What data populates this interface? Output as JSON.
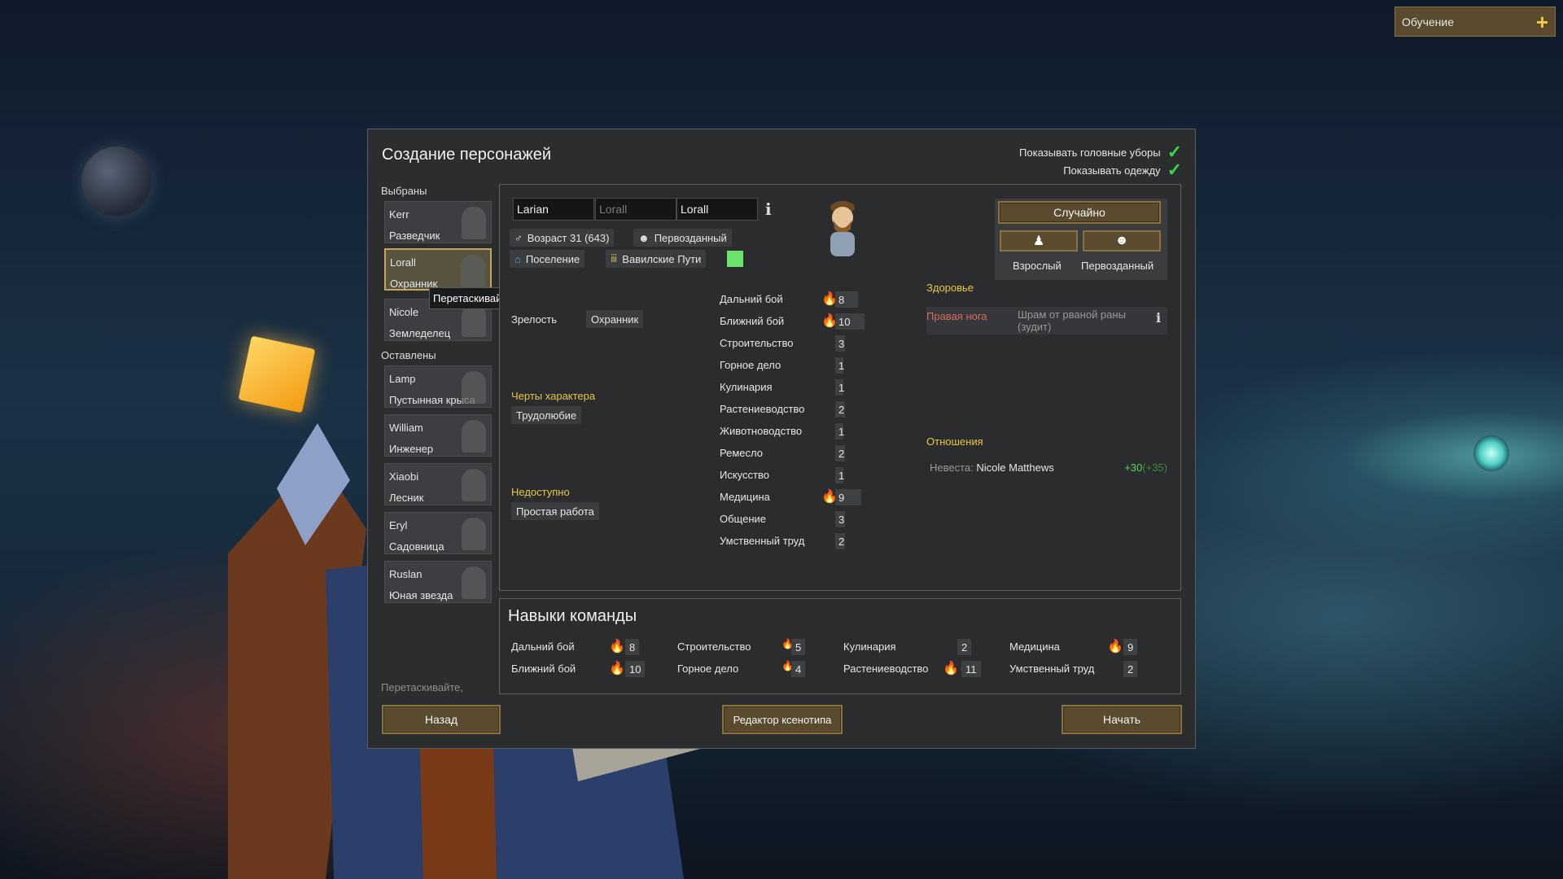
{
  "tutorial": {
    "label": "Обучение"
  },
  "dialog": {
    "title": "Создание персонажей",
    "toggles": [
      {
        "label": "Показывать головные уборы"
      },
      {
        "label": "Показывать одежду"
      }
    ],
    "chosen_label": "Выбраны",
    "left_label": "Оставлены",
    "chosen": [
      {
        "name": "Kerr",
        "role": "Разведчик"
      },
      {
        "name": "Lorall",
        "role": "Охранник"
      },
      {
        "name": "Nicole",
        "role": "Земледелец"
      }
    ],
    "left": [
      {
        "name": "Lamp",
        "role": "Пустынная крыса"
      },
      {
        "name": "William",
        "role": "Инженер"
      },
      {
        "name": "Xiaobi",
        "role": "Лесник"
      },
      {
        "name": "Eryl",
        "role": "Садовница"
      },
      {
        "name": "Ruslan",
        "role": "Юная звезда"
      }
    ],
    "tooltip": "Перетаскивайте, чтобы упорядочить.",
    "drag_hint": "Перетаскивайте,",
    "pawn": {
      "first_name": "Larian",
      "nick_placeholder": "Lorall",
      "last_name": "Lorall",
      "age": "Возраст 31 (643)",
      "xeno": "Первозданный",
      "faction": "Поселение",
      "ideo": "Вавилские Пути",
      "backstory_label": "Зрелость",
      "backstory_value": "Охранник",
      "traits_label": "Черты характера",
      "traits": [
        "Трудолюбие"
      ],
      "unavailable_label": "Недоступно",
      "unavailable": [
        "Простая работа"
      ]
    },
    "buttons": {
      "random": "Случайно",
      "adult": "Взрослый",
      "xeno": "Первозданный",
      "back": "Назад",
      "editor": "Редактор ксенотипа",
      "start": "Начать"
    },
    "skills": [
      {
        "name": "Дальний бой",
        "passion": "🔥🔥",
        "value": "8"
      },
      {
        "name": "Ближний бой",
        "passion": "🔥🔥",
        "value": "10"
      },
      {
        "name": "Строительство",
        "passion": "",
        "value": "3"
      },
      {
        "name": "Горное дело",
        "passion": "",
        "value": "1"
      },
      {
        "name": "Кулинария",
        "passion": "",
        "value": "1"
      },
      {
        "name": "Растениеводство",
        "passion": "",
        "value": "2"
      },
      {
        "name": "Животноводство",
        "passion": "",
        "value": "1"
      },
      {
        "name": "Ремесло",
        "passion": "",
        "value": "2"
      },
      {
        "name": "Искусство",
        "passion": "",
        "value": "1"
      },
      {
        "name": "Медицина",
        "passion": "🔥🔥",
        "value": "9"
      },
      {
        "name": "Общение",
        "passion": "",
        "value": "3"
      },
      {
        "name": "Умственный труд",
        "passion": "",
        "value": "2"
      }
    ],
    "health": {
      "label": "Здоровье",
      "part": "Правая нога",
      "condition": "Шрам от рваной раны (зудит)"
    },
    "relations": {
      "label": "Отношения",
      "kind": "Невеста:",
      "person": "Nicole Matthews",
      "value": "+30",
      "value_extra": "(+35)"
    },
    "team": {
      "title": "Навыки команды",
      "skills": [
        {
          "name": "Дальний бой",
          "passion": "🔥🔥",
          "value": "8"
        },
        {
          "name": "Ближний бой",
          "passion": "🔥🔥",
          "value": "10"
        },
        {
          "name": "Строительство",
          "passion": "🔥",
          "value": "5"
        },
        {
          "name": "Горное дело",
          "passion": "🔥",
          "value": "4"
        },
        {
          "name": "Кулинария",
          "passion": "",
          "value": "2"
        },
        {
          "name": "Растениеводство",
          "passion": "🔥🔥",
          "value": "11"
        },
        {
          "name": "Медицина",
          "passion": "🔥🔥",
          "value": "9"
        },
        {
          "name": "Умственный труд",
          "passion": "",
          "value": "2"
        }
      ]
    }
  },
  "colors": {
    "accent": "#e9c547",
    "button": "#5a4a2e",
    "check": "#39d84a",
    "ideo_color": "#6be36b",
    "health_red": "#d96b5f",
    "relation_green": "#5fd65f"
  }
}
